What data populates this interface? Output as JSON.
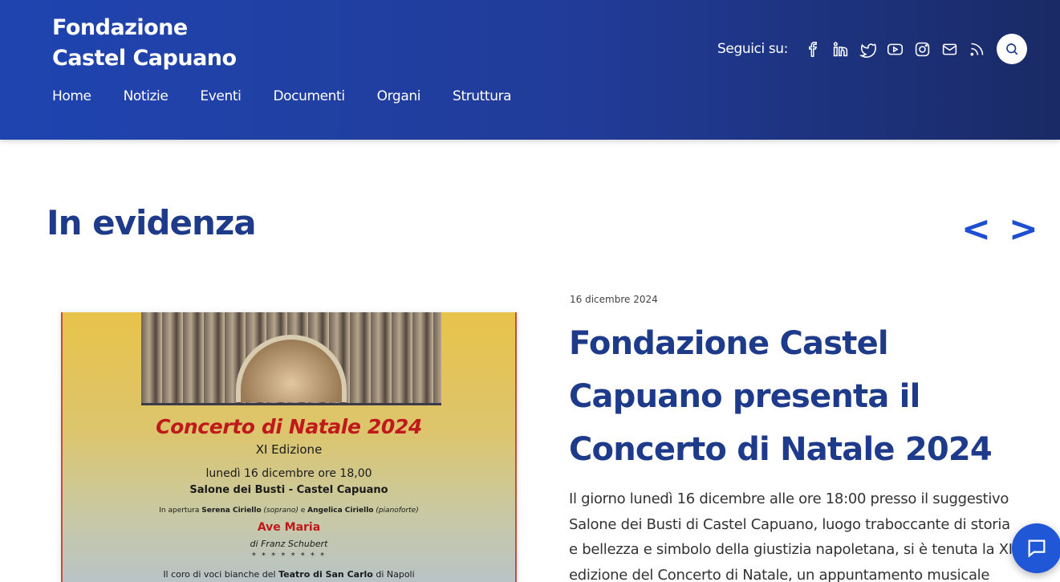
{
  "header": {
    "brand_line1": "Fondazione",
    "brand_line2": "Castel Capuano",
    "nav": [
      "Home",
      "Notizie",
      "Eventi",
      "Documenti",
      "Organi",
      "Struttura"
    ],
    "social_label": "Seguici su:",
    "social_icons": [
      "facebook-icon",
      "linkedin-icon",
      "twitter-icon",
      "youtube-icon",
      "instagram-icon",
      "mail-icon",
      "rss-icon"
    ],
    "search_icon": "search-icon"
  },
  "highlight": {
    "title": "In evidenza",
    "prev": "<",
    "next": ">"
  },
  "article": {
    "date": "16 dicembre 2024",
    "headline": "Fondazione Castel Capuano presenta il Concerto di Natale 2024",
    "excerpt": "Il giorno lunedì 16 dicembre alle ore 18:00 presso il suggestivo Salone dei Busti di Castel Capuano, luogo traboccante di storia e bellezza e simbolo della giustizia napoletana, si è tenuta la XI edizione del Concerto di Natale, un appuntamento musicale"
  },
  "poster": {
    "title": "Concerto di Natale 2024",
    "edition": "XI Edizione",
    "date": "lunedì 16 dicembre ore 18,00",
    "venue": "Salone dei Busti - Castel Capuano",
    "opening_prefix": "In apertura ",
    "opening_soprano": "Serena Ciriello",
    "opening_soprano_role": " (soprano)",
    "opening_and": " e ",
    "opening_piano": "Angelica Ciriello",
    "opening_piano_role": " (pianoforte)",
    "piece": "Ave Maria",
    "composer": "di Franz Schubert",
    "stars": "* * * * * * * *",
    "choir_prefix": "Il coro di voci bianche del ",
    "choir_theatre": "Teatro di San Carlo",
    "choir_suffix": " di Napoli"
  },
  "colors": {
    "header_start": "#1f44b0",
    "header_end": "#1a2a66",
    "title_blue": "#1e3a8a",
    "accent_blue": "#1f57d6",
    "poster_red": "#c0191b"
  },
  "chat_icon": "chat-icon"
}
